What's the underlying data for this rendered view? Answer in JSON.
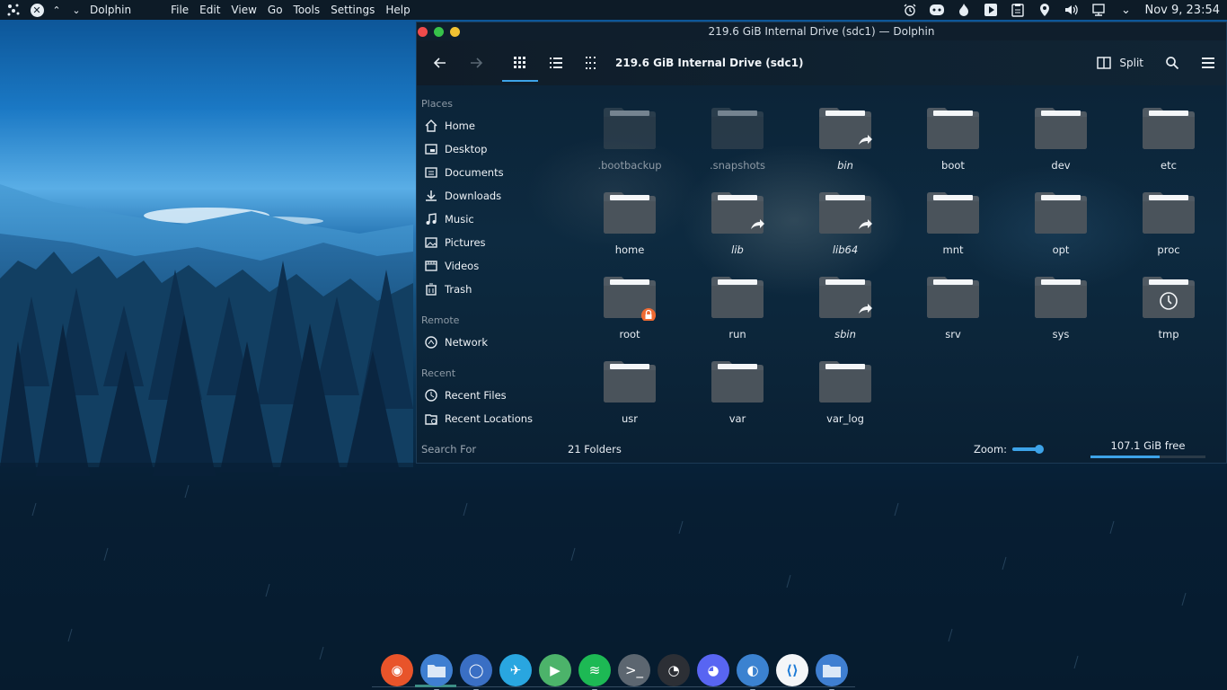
{
  "top_panel": {
    "app_name": "Dolphin",
    "menu": [
      "File",
      "Edit",
      "View",
      "Go",
      "Tools",
      "Settings",
      "Help"
    ],
    "clock": "Nov 9, 23:54",
    "tray_icons": [
      "alarm-icon",
      "discord-icon",
      "flame-icon",
      "media-player-icon",
      "clipboard-icon",
      "location-icon",
      "volume-icon",
      "network-icon",
      "chevron-down-icon"
    ]
  },
  "window": {
    "title": "219.6 GiB Internal Drive (sdc1) — Dolphin",
    "path_label": "219.6 GiB Internal Drive (sdc1)",
    "split_label": "Split",
    "view_mode": "icons"
  },
  "sidebar": {
    "places_label": "Places",
    "places": [
      {
        "label": "Home",
        "icon": "home-icon"
      },
      {
        "label": "Desktop",
        "icon": "desktop-icon"
      },
      {
        "label": "Documents",
        "icon": "documents-icon"
      },
      {
        "label": "Downloads",
        "icon": "downloads-icon"
      },
      {
        "label": "Music",
        "icon": "music-icon"
      },
      {
        "label": "Pictures",
        "icon": "pictures-icon"
      },
      {
        "label": "Videos",
        "icon": "videos-icon"
      },
      {
        "label": "Trash",
        "icon": "trash-icon"
      }
    ],
    "remote_label": "Remote",
    "remote": [
      {
        "label": "Network",
        "icon": "network-icon"
      }
    ],
    "recent_label": "Recent",
    "recent": [
      {
        "label": "Recent Files",
        "icon": "recent-files-icon"
      },
      {
        "label": "Recent Locations",
        "icon": "recent-locations-icon"
      }
    ]
  },
  "folders": [
    {
      "name": ".bootbackup",
      "hidden": true,
      "link": false,
      "emblem": ""
    },
    {
      "name": ".snapshots",
      "hidden": true,
      "link": false,
      "emblem": ""
    },
    {
      "name": "bin",
      "hidden": false,
      "link": true,
      "emblem": "link"
    },
    {
      "name": "boot",
      "hidden": false,
      "link": false,
      "emblem": ""
    },
    {
      "name": "dev",
      "hidden": false,
      "link": false,
      "emblem": ""
    },
    {
      "name": "etc",
      "hidden": false,
      "link": false,
      "emblem": ""
    },
    {
      "name": "home",
      "hidden": false,
      "link": false,
      "emblem": ""
    },
    {
      "name": "lib",
      "hidden": false,
      "link": true,
      "emblem": "link"
    },
    {
      "name": "lib64",
      "hidden": false,
      "link": true,
      "emblem": "link"
    },
    {
      "name": "mnt",
      "hidden": false,
      "link": false,
      "emblem": ""
    },
    {
      "name": "opt",
      "hidden": false,
      "link": false,
      "emblem": ""
    },
    {
      "name": "proc",
      "hidden": false,
      "link": false,
      "emblem": ""
    },
    {
      "name": "root",
      "hidden": false,
      "link": false,
      "emblem": "lock"
    },
    {
      "name": "run",
      "hidden": false,
      "link": false,
      "emblem": ""
    },
    {
      "name": "sbin",
      "hidden": false,
      "link": true,
      "emblem": "link"
    },
    {
      "name": "srv",
      "hidden": false,
      "link": false,
      "emblem": ""
    },
    {
      "name": "sys",
      "hidden": false,
      "link": false,
      "emblem": ""
    },
    {
      "name": "tmp",
      "hidden": false,
      "link": false,
      "emblem": "clock"
    },
    {
      "name": "usr",
      "hidden": false,
      "link": false,
      "emblem": ""
    },
    {
      "name": "var",
      "hidden": false,
      "link": false,
      "emblem": ""
    },
    {
      "name": "var_log",
      "hidden": false,
      "link": false,
      "emblem": ""
    }
  ],
  "statusbar": {
    "search_for": "Search For",
    "folder_count": "21 Folders",
    "zoom_label": "Zoom:",
    "free_space": "107.1 GiB free",
    "used_fraction": 0.6
  },
  "dock": [
    {
      "name": "firefox",
      "color": "#e8542a",
      "glyph": "◉"
    },
    {
      "name": "files-dolphin",
      "color": "#3f7fd1",
      "glyph": ""
    },
    {
      "name": "chromium",
      "color": "#3a6fc4",
      "glyph": "◯"
    },
    {
      "name": "kdeconnect-bird",
      "color": "#29a6e0",
      "glyph": "✈"
    },
    {
      "name": "media-player",
      "color": "#4cb36a",
      "glyph": "▶"
    },
    {
      "name": "spotify",
      "color": "#1db954",
      "glyph": "≋"
    },
    {
      "name": "terminal",
      "color": "#5c6670",
      "glyph": ">_"
    },
    {
      "name": "obs-studio",
      "color": "#2c2f35",
      "glyph": "◔"
    },
    {
      "name": "discord",
      "color": "#5865f2",
      "glyph": "◕"
    },
    {
      "name": "settings-toggle",
      "color": "#3b82d0",
      "glyph": "◐"
    },
    {
      "name": "vscode",
      "color": "#f4f6f8",
      "glyph": "⟨⟩"
    },
    {
      "name": "files-folder",
      "color": "#3f7fd1",
      "glyph": ""
    }
  ],
  "colors": {
    "accent": "#3da3e8",
    "panel": "#0d1b27",
    "folder": "#505a63",
    "emblem_lock": "#ef6a32"
  }
}
